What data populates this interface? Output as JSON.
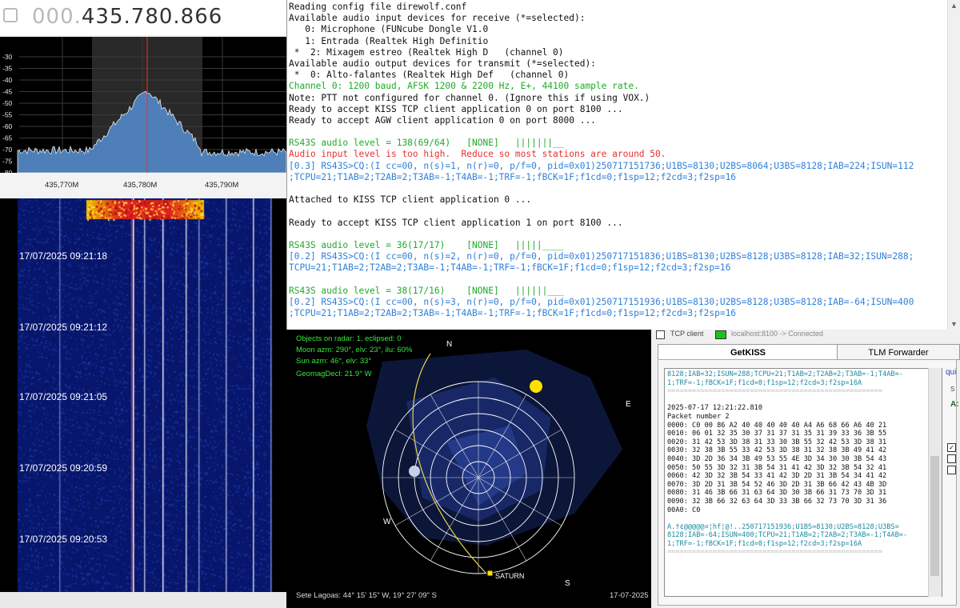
{
  "sdr": {
    "frequency_prefix": "000.",
    "frequency_main": "435.780.866",
    "db_ticks": [
      "-30",
      "-35",
      "-40",
      "-45",
      "-50",
      "-55",
      "-60",
      "-65",
      "-70",
      "-75",
      "-80"
    ],
    "freq_ticks": [
      "435,770M",
      "435,780M",
      "435,790M"
    ],
    "waterfall_times": [
      "17/07/2025 09:21:18",
      "17/07/2025 09:21:12",
      "17/07/2025 09:21:05",
      "17/07/2025 09:20:59",
      "17/07/2025 09:20:53"
    ],
    "colors": {
      "spectrum_fill": "#4e7fb8",
      "center_line": "#ff2a2a",
      "waterfall_bg": "#08186a"
    }
  },
  "terminal": {
    "lines": [
      {
        "c": "black",
        "t": "Reading config file direwolf.conf"
      },
      {
        "c": "black",
        "t": "Available audio input devices for receive (*=selected):"
      },
      {
        "c": "black",
        "t": "   0: Microphone (FUNcube Dongle V1.0"
      },
      {
        "c": "black",
        "t": "   1: Entrada (Realtek High Definitio"
      },
      {
        "c": "black",
        "t": " *  2: Mixagem estreo (Realtek High D   (channel 0)"
      },
      {
        "c": "black",
        "t": "Available audio output devices for transmit (*=selected):"
      },
      {
        "c": "black",
        "t": " *  0: Alto-falantes (Realtek High Def   (channel 0)"
      },
      {
        "c": "green",
        "t": "Channel 0: 1200 baud, AFSK 1200 & 2200 Hz, E+, 44100 sample rate."
      },
      {
        "c": "black",
        "t": "Note: PTT not configured for channel 0. (Ignore this if using VOX.)"
      },
      {
        "c": "black",
        "t": "Ready to accept KISS TCP client application 0 on port 8100 ..."
      },
      {
        "c": "black",
        "t": "Ready to accept AGW client application 0 on port 8000 ..."
      },
      {
        "c": "black",
        "t": ""
      },
      {
        "c": "green",
        "t": "RS43S audio level = 138(69/64)   [NONE]   |||||||__"
      },
      {
        "c": "red",
        "t": "Audio input level is too high.  Reduce so most stations are around 50."
      },
      {
        "c": "blue",
        "t": "[0.3] RS43S>CQ:(I cc=00, n(s)=1, n(r)=0, p/f=0, pid=0x01)250717151736;U1BS=8130;U2BS=8064;U3BS=8128;IAB=224;ISUN=112"
      },
      {
        "c": "blue",
        "t": ";TCPU=21;T1AB=2;T2AB=2;T3AB=-1;T4AB=-1;TRF=-1;fBCK=1F;f1cd=0;f1sp=12;f2cd=3;f2sp=16"
      },
      {
        "c": "black",
        "t": ""
      },
      {
        "c": "black",
        "t": "Attached to KISS TCP client application 0 ..."
      },
      {
        "c": "black",
        "t": ""
      },
      {
        "c": "black",
        "t": "Ready to accept KISS TCP client application 1 on port 8100 ..."
      },
      {
        "c": "black",
        "t": ""
      },
      {
        "c": "green",
        "t": "RS43S audio level = 36(17/17)    [NONE]   |||||____"
      },
      {
        "c": "blue",
        "t": "[0.2] RS43S>CQ:(I cc=00, n(s)=2, n(r)=0, p/f=0, pid=0x01)250717151836;U1BS=8130;U2BS=8128;U3BS=8128;IAB=32;ISUN=288;"
      },
      {
        "c": "blue",
        "t": "TCPU=21;T1AB=2;T2AB=2;T3AB=-1;T4AB=-1;TRF=-1;fBCK=1F;f1cd=0;f1sp=12;f2cd=3;f2sp=16"
      },
      {
        "c": "black",
        "t": ""
      },
      {
        "c": "green",
        "t": "RS43S audio level = 38(17/16)    [NONE]   ||||||___"
      },
      {
        "c": "blue",
        "t": "[0.2] RS43S>CQ:(I cc=00, n(s)=3, n(r)=0, p/f=0, pid=0x01)250717151936;U1BS=8130;U2BS=8128;U3BS=8128;IAB=-64;ISUN=400"
      },
      {
        "c": "blue",
        "t": ";TCPU=21;T1AB=2;T2AB=2;T3AB=-1;T4AB=-1;TRF=-1;fBCK=1F;f1cd=0;f1sp=12;f2cd=3;f2sp=16"
      }
    ],
    "scroll_up": "▲",
    "scroll_down": "▼"
  },
  "radar": {
    "info": [
      "Objects on radar: 1, eclipsed: 0",
      "Moon azm: 290°, elv: 23°, ilu: 60%",
      "Sun azm: 46°, elv: 33°",
      "GeomagDecl: 21.9° W"
    ],
    "north": "N",
    "east": "E",
    "south": "S",
    "west": "W",
    "object_label": "SATURN",
    "location": "Sete Lagoas: 44° 15' 15\" W, 19° 27' 09\" S",
    "date": "17-07-2025"
  },
  "kiss": {
    "tcp_client_label": "TCP client",
    "tcp_status": "localhost:8100 -> Connected",
    "tabs": [
      "GetKISS",
      "TLM Forwarder"
    ],
    "side_text": "qui",
    "side_s": "S",
    "side_a": "A:",
    "lines": [
      {
        "c": "teal",
        "t": "8128;IAB=32;ISUN=288;TCPU=21;T1AB=2;T2AB=2;T3AB=-1;T4AB=-"
      },
      {
        "c": "teal",
        "t": "1;TRF=-1;fBCK=1F;f1cd=0;f1sp=12;f2cd=3;f2sp=16À"
      },
      {
        "c": "sep",
        "t": "===================================================="
      },
      {
        "c": "dark",
        "t": ""
      },
      {
        "c": "dark",
        "t": "2025-07-17 12:21:22.810"
      },
      {
        "c": "dark",
        "t": "Packet number 2"
      },
      {
        "c": "dark",
        "t": "0000: C0 00 86 A2 40 40 40 40 40 A4 A6 68 66 A6 40 21"
      },
      {
        "c": "dark",
        "t": "0010: 06 01 32 35 30 37 31 37 31 35 31 39 33 36 3B 55"
      },
      {
        "c": "dark",
        "t": "0020: 31 42 53 3D 38 31 33 30 3B 55 32 42 53 3D 38 31"
      },
      {
        "c": "dark",
        "t": "0030: 32 38 3B 55 33 42 53 3D 38 31 32 38 3B 49 41 42"
      },
      {
        "c": "dark",
        "t": "0040: 3D 2D 36 34 3B 49 53 55 4E 3D 34 30 30 3B 54 43"
      },
      {
        "c": "dark",
        "t": "0050: 50 55 3D 32 31 3B 54 31 41 42 3D 32 3B 54 32 41"
      },
      {
        "c": "dark",
        "t": "0060: 42 3D 32 3B 54 33 41 42 3D 2D 31 3B 54 34 41 42"
      },
      {
        "c": "dark",
        "t": "0070: 3D 2D 31 3B 54 52 46 3D 2D 31 3B 66 42 43 4B 3D"
      },
      {
        "c": "dark",
        "t": "0080: 31 46 3B 66 31 63 64 3D 30 3B 66 31 73 70 3D 31"
      },
      {
        "c": "dark",
        "t": "0090: 32 3B 66 32 63 64 3D 33 3B 66 32 73 70 3D 31 36"
      },
      {
        "c": "dark",
        "t": "00A0: C0"
      },
      {
        "c": "dark",
        "t": ""
      },
      {
        "c": "teal",
        "t": "À.†¢@@@@@¤¦hf¦@!..250717151936;U1BS=8130;U2BS=8128;U3BS="
      },
      {
        "c": "teal",
        "t": "8128;IAB=-64;ISUN=400;TCPU=21;T1AB=2;T2AB=2;T3AB=-1;T4AB=-"
      },
      {
        "c": "teal",
        "t": "1;TRF=-1;fBCK=1F;f1cd=0;f1sp=12;f2cd=3;f2sp=16À"
      },
      {
        "c": "sep",
        "t": "===================================================="
      }
    ]
  }
}
